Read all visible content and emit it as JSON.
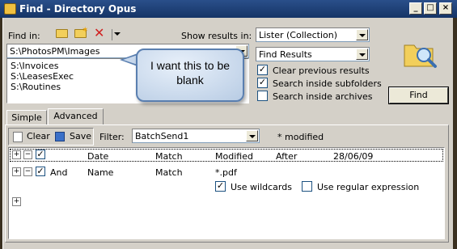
{
  "window": {
    "title": "Find - Directory Opus",
    "controls": {
      "minimize": "_",
      "maximize": "□",
      "close": "×"
    }
  },
  "find_in": {
    "label": "Find in:",
    "path_value": "S:\\PhotosPM\\Images",
    "paths": [
      "S:\\Invoices",
      "S:\\LeasesExec",
      "S:\\Routines"
    ]
  },
  "show_results": {
    "label": "Show results in:",
    "value": "Lister (Collection)",
    "collection_value": "Find Results"
  },
  "options": [
    {
      "label": "Clear previous results",
      "checked": true
    },
    {
      "label": "Search inside subfolders",
      "checked": true
    },
    {
      "label": "Search inside archives",
      "checked": false
    }
  ],
  "find_button": "Find",
  "callout": {
    "line1": "I want this to be",
    "line2": "blank"
  },
  "tabs": [
    "Simple",
    "Advanced"
  ],
  "advanced_toolbar": {
    "clear_label": "Clear",
    "save_label": "Save",
    "filter_label": "Filter:",
    "filter_value": "BatchSend1",
    "modified_note": "* modified"
  },
  "clauses": [
    {
      "conj": "",
      "field": "Date",
      "op": "Match",
      "attr": "Modified",
      "cmp": "After",
      "value": "28/06/09"
    },
    {
      "conj": "And",
      "field": "Name",
      "op": "Match",
      "attr": "*.pdf",
      "cmp": "",
      "value": ""
    }
  ],
  "clause_options": {
    "use_wildcards": "Use wildcards",
    "use_wildcards_checked": true,
    "use_regex": "Use regular expression",
    "use_regex_checked": false
  },
  "colors": {
    "titlebar": "#153466",
    "dialog": "#d4d0c8",
    "callout_border": "#5a7fb0"
  }
}
